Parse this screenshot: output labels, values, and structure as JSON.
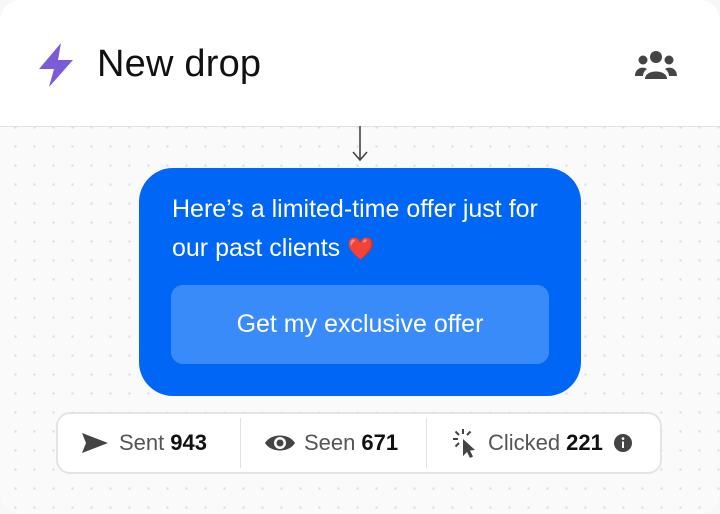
{
  "header": {
    "title": "New drop",
    "icons": {
      "left": "lightning-bolt-icon",
      "right": "users-group-icon"
    }
  },
  "message": {
    "text": "Here’s a limited-time offer just for our past clients",
    "emoji": "❤️",
    "button_label": "Get my exclusive offer"
  },
  "stats": [
    {
      "label": "Sent",
      "value": "943",
      "icon": "send-icon"
    },
    {
      "label": "Seen",
      "value": "671",
      "icon": "eye-icon"
    },
    {
      "label": "Clicked",
      "value": "221",
      "icon": "cursor-click-icon"
    }
  ],
  "colors": {
    "bubble": "#0066f5",
    "button": "#3a8bfa",
    "bolt": "#7b5cd6"
  }
}
